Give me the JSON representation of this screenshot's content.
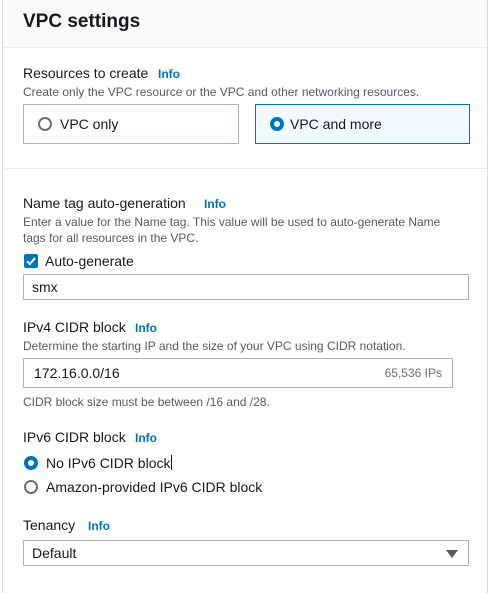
{
  "panel": {
    "title": "VPC settings"
  },
  "resources": {
    "label": "Resources to create",
    "info": "Info",
    "description": "Create only the VPC resource or the VPC and other networking resources.",
    "options": [
      {
        "label": "VPC only",
        "selected": false
      },
      {
        "label": "VPC and more",
        "selected": true
      }
    ]
  },
  "name_tag": {
    "label": "Name tag auto-generation",
    "info": "Info",
    "description_line1": "Enter a value for the Name tag. This value will be used to auto-generate Name",
    "description_line2": "tags for all resources in the VPC.",
    "checkbox_label": "Auto-generate",
    "checked": true,
    "value": "smx"
  },
  "ipv4": {
    "label": "IPv4 CIDR block",
    "info": "Info",
    "description": "Determine the starting IP and the size of your VPC using CIDR notation.",
    "value": "172.16.0.0/16",
    "suffix": "65,536 IPs",
    "hint": "CIDR block size must be between /16 and /28."
  },
  "ipv6": {
    "label": "IPv6 CIDR block",
    "info": "Info",
    "options": [
      {
        "label": "No IPv6 CIDR block",
        "selected": true
      },
      {
        "label": "Amazon-provided IPv6 CIDR block",
        "selected": false
      }
    ]
  },
  "tenancy": {
    "label": "Tenancy",
    "info": "Info",
    "value": "Default"
  },
  "colors": {
    "accent": "#0073bb",
    "border": "#aab7b8",
    "text": "#16191f",
    "muted": "#545b64"
  },
  "icons": {
    "checkbox": "checkmark-icon",
    "dropdown": "caret-down-icon"
  }
}
